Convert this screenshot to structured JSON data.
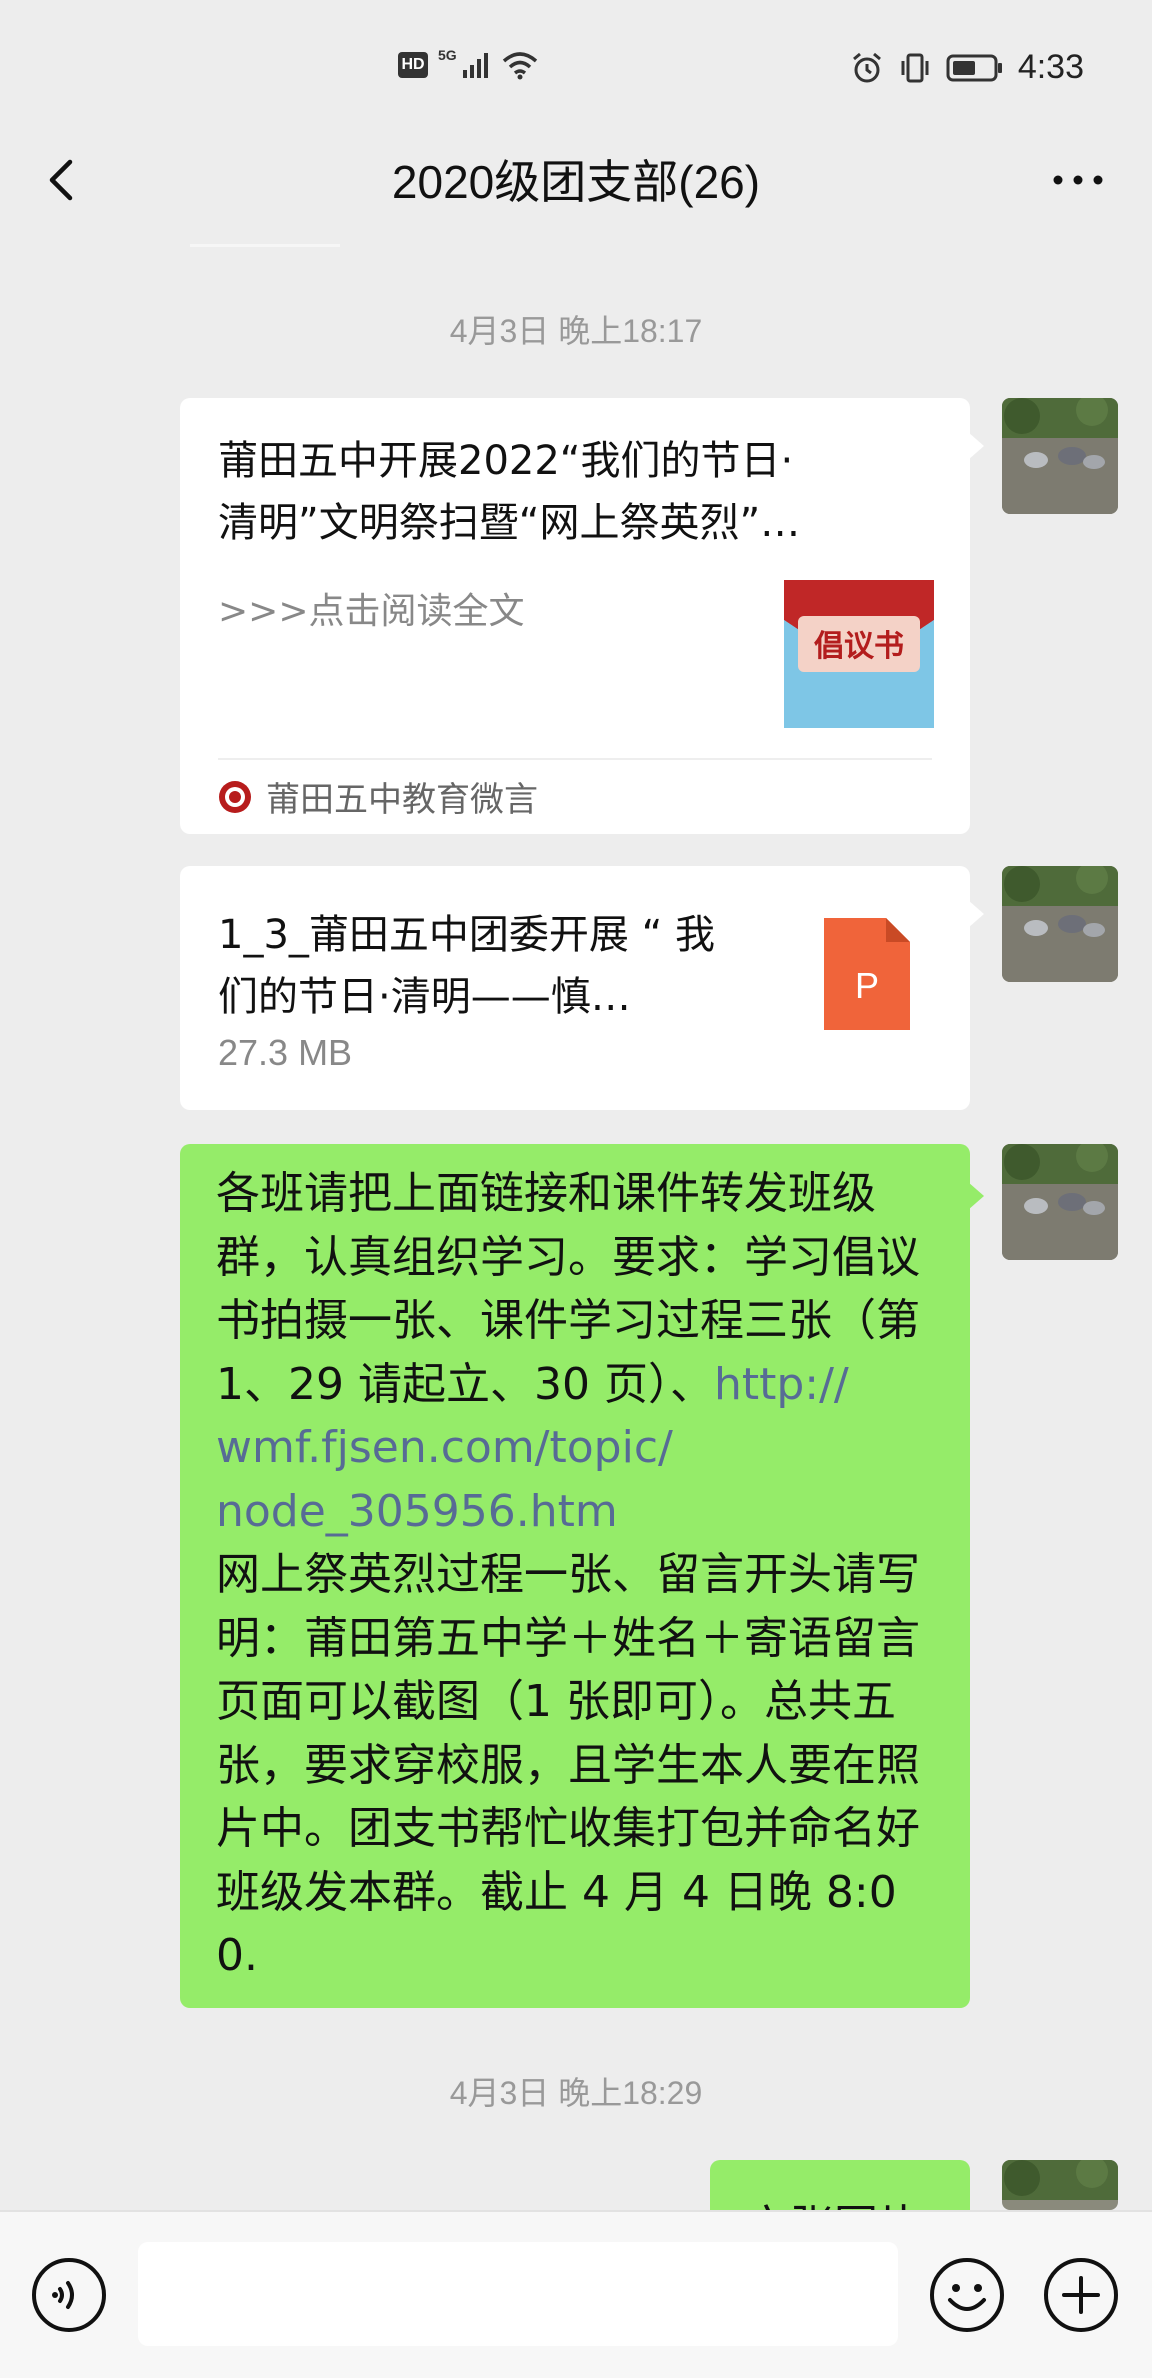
{
  "status_bar": {
    "hd": "HD",
    "network": "5G",
    "time": "4:33",
    "icons": [
      "signal-icon",
      "wifi-icon",
      "alarm-icon",
      "vibrate-icon",
      "battery-icon"
    ]
  },
  "header": {
    "title": "2020级团支部(26)",
    "back_icon": "chevron-left-icon",
    "more_icon": "more-dots-icon"
  },
  "timestamps": [
    "4月3日 晚上18:17",
    "4月3日 晚上18:29"
  ],
  "messages": [
    {
      "type": "link",
      "title_line1": "莆田五中开展2022“我们的节日·",
      "title_line2": "清明”文明祭扫暨“网上祭英烈”…",
      "desc": ">>>点击阅读全文",
      "thumb_text": "倡议书",
      "source": "莆田五中教育微言"
    },
    {
      "type": "file",
      "name_line1": "1_3_莆田五中团委开展 “ 我",
      "name_line2": "们的节日·清明——慎…",
      "size": "27.3 MB",
      "icon_letter": "P"
    },
    {
      "type": "text",
      "text_before": "各班请把上面链接和课件转发班级群，认真组织学习。要求：学习倡议书拍摄一张、课件学习过程三张（第 1、29 请起立、30 页）、",
      "link1": "http://",
      "link2": "wmf.fjsen.com/topic/",
      "link3": "node_305956.htm",
      "text_after": "网上祭英烈过程一张、留言开头请写明：莆田第五中学＋姓名＋寄语留言页面可以截图（1 张即可）。总共五张，要求穿校服，且学生本人要在照片中。团支书帮忙收集打包并命名好班级发本群。截止 4 月 4 日晚 8:00."
    },
    {
      "type": "text_partial",
      "text": "六张图片"
    }
  ],
  "input_bar": {
    "voice_icon": "voice-icon",
    "emoji_icon": "emoji-icon",
    "plus_icon": "plus-icon"
  },
  "colors": {
    "background": "#ededed",
    "bubble_green": "#95ec69",
    "link": "#576b95",
    "ppt_orange": "#f0643a"
  }
}
